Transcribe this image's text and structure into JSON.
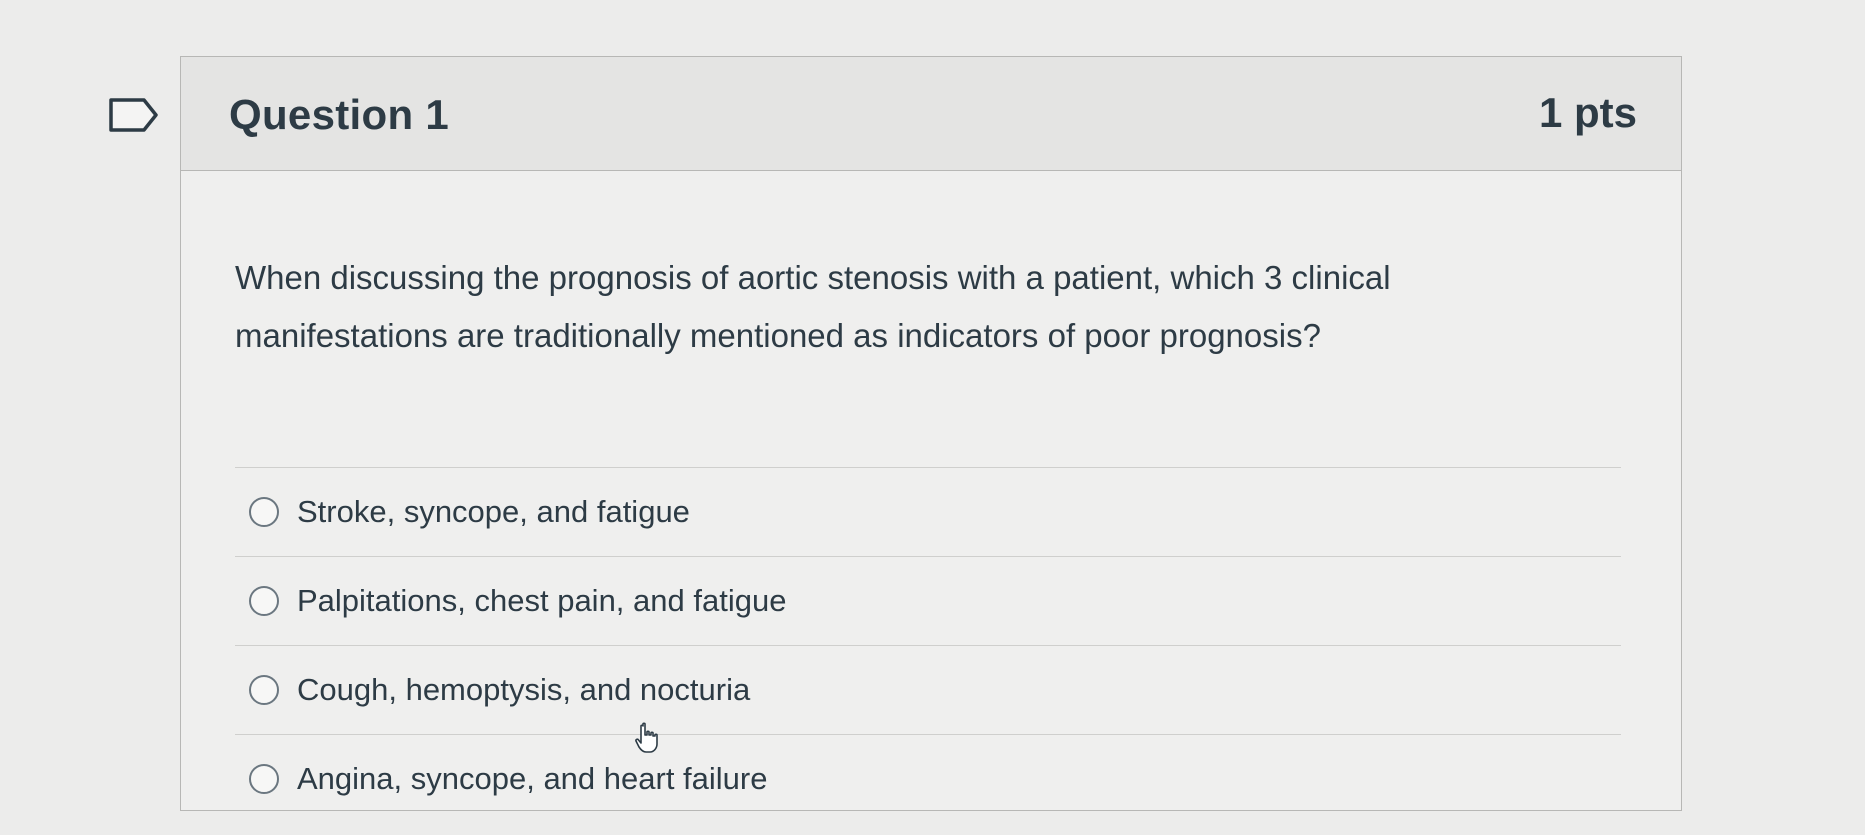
{
  "question": {
    "title": "Question 1",
    "points": "1 pts",
    "text": "When discussing the prognosis of aortic stenosis with a patient, which 3 clinical manifestations are traditionally mentioned as indicators of poor prognosis?"
  },
  "answers": [
    {
      "label": "Stroke, syncope, and fatigue"
    },
    {
      "label": "Palpitations, chest pain, and fatigue"
    },
    {
      "label": "Cough, hemoptysis, and nocturia"
    },
    {
      "label": "Angina, syncope, and heart failure"
    }
  ],
  "icons": {
    "flag": "flag-question-icon",
    "radio": "radio-unselected-icon",
    "cursor": "mouse-pointer-icon"
  },
  "colors": {
    "text": "#2d3b45",
    "header_bg": "#e4e4e3",
    "border": "#b7b7b5"
  }
}
